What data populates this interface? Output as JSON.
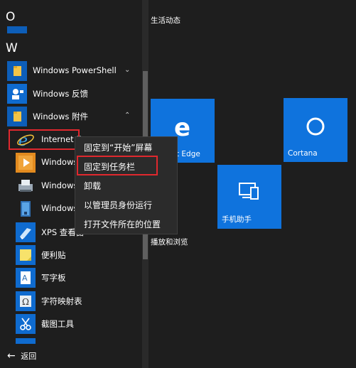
{
  "start_menu": {
    "letters": [
      "O",
      "W"
    ],
    "apps": [
      {
        "label": "Windows PowerShell",
        "icon": "folder-icon",
        "expand": "v"
      },
      {
        "label": "Windows 反馈",
        "icon": "feedback-icon",
        "expand": ""
      },
      {
        "label": "Windows 附件",
        "icon": "folder-icon",
        "expand": "^"
      },
      {
        "label": "Internet E",
        "icon": "internet-explorer-icon"
      },
      {
        "label": "Windows",
        "icon": "media-player-icon"
      },
      {
        "label": "Windows",
        "icon": "fax-scan-icon"
      },
      {
        "label": "Windows",
        "icon": "journal-icon"
      },
      {
        "label": "XPS 查看器",
        "icon": "xps-viewer-icon"
      },
      {
        "label": "便利贴",
        "icon": "sticky-notes-icon"
      },
      {
        "label": "写字板",
        "icon": "wordpad-icon"
      },
      {
        "label": "字符映射表",
        "icon": "character-map-icon"
      },
      {
        "label": "截图工具",
        "icon": "snipping-tool-icon"
      }
    ],
    "back_label": "返回"
  },
  "tiles": {
    "group1_title": "生活动态",
    "group2_title": "播放和浏览",
    "edge_label": "oft Edge",
    "cortana_label": "Cortana",
    "phone_label": "手机助手"
  },
  "context_menu": {
    "items": [
      "固定到“开始”屏幕",
      "固定到任务栏",
      "卸载",
      "以管理员身份运行",
      "打开文件所在的位置"
    ]
  },
  "colors": {
    "tile_blue": "#0f73dd",
    "highlight_red": "#e0282e",
    "menu_bg": "#2b2b2b"
  }
}
